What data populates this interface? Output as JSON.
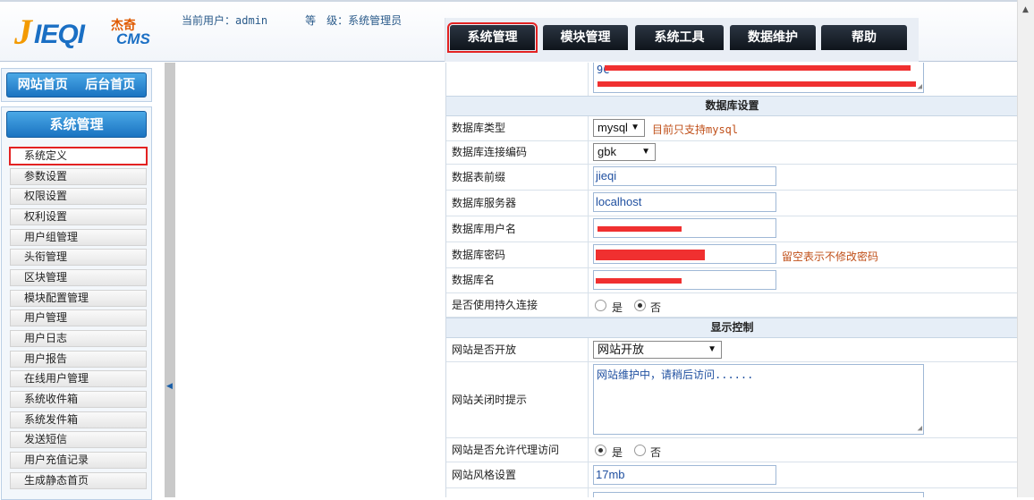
{
  "brand": {
    "logo_ji": "J",
    "logo_ieqi": "IEQI",
    "logo_cn": "杰奇",
    "logo_cms": "CMS"
  },
  "header": {
    "current_user_label": "当前用户：",
    "current_user": "admin",
    "level_label": "等　级：",
    "level": "系统管理员"
  },
  "tabs": [
    {
      "label": "系统管理",
      "active": true
    },
    {
      "label": "模块管理"
    },
    {
      "label": "系统工具"
    },
    {
      "label": "数据维护"
    },
    {
      "label": "帮助"
    }
  ],
  "sidebar": {
    "home_link": "网站首页",
    "admin_home_link": "后台首页",
    "panel_title": "系统管理",
    "items": [
      {
        "label": "系统定义",
        "active": true
      },
      {
        "label": "参数设置"
      },
      {
        "label": "权限设置"
      },
      {
        "label": "权利设置"
      },
      {
        "label": "用户组管理"
      },
      {
        "label": "头衔管理"
      },
      {
        "label": "区块管理"
      },
      {
        "label": "模块配置管理"
      },
      {
        "label": "用户管理"
      },
      {
        "label": "用户日志"
      },
      {
        "label": "用户报告"
      },
      {
        "label": "在线用户管理"
      },
      {
        "label": "系统收件箱"
      },
      {
        "label": "系统发件箱"
      },
      {
        "label": "发送短信"
      },
      {
        "label": "用户充值记录"
      },
      {
        "label": "生成静态首页"
      }
    ]
  },
  "form": {
    "top_textarea_text": "9C",
    "db_section_title": "数据库设置",
    "db_type": {
      "label": "数据库类型",
      "value": "mysql",
      "note": "目前只支持mysql"
    },
    "db_charset": {
      "label": "数据库连接编码",
      "value": "gbk"
    },
    "db_prefix": {
      "label": "数据表前缀",
      "value": "jieqi"
    },
    "db_server": {
      "label": "数据库服务器",
      "value": "localhost"
    },
    "db_user": {
      "label": "数据库用户名"
    },
    "db_password": {
      "label": "数据库密码",
      "note": "留空表示不修改密码"
    },
    "db_name": {
      "label": "数据库名"
    },
    "db_persistent": {
      "label": "是否使用持久连接",
      "yes": "是",
      "no": "否",
      "selected": "no"
    },
    "display_section_title": "显示控制",
    "site_open": {
      "label": "网站是否开放",
      "value": "网站开放"
    },
    "site_close_tip": {
      "label": "网站关闭时提示",
      "value": "网站维护中，请稍后访问......"
    },
    "proxy_access": {
      "label": "网站是否允许代理访问",
      "yes": "是",
      "no": "否",
      "selected": "yes"
    },
    "site_style": {
      "label": "网站风格设置",
      "value": "17mb"
    }
  },
  "colors": {
    "accent_blue": "#1a73c1",
    "highlight_red": "#e32222",
    "note_orange": "#c0501a"
  }
}
